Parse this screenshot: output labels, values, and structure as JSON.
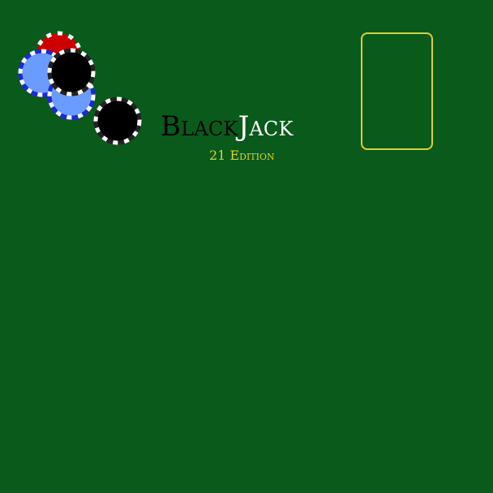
{
  "game": {
    "title_part1": "Black",
    "title_part2": "Jack",
    "subtitle": "21 Edition"
  },
  "colors": {
    "felt": "#095a1b",
    "accent": "#e2cf2a",
    "chip_red": "#cc0000",
    "chip_blue": "#6a9cff",
    "chip_blue_edge": "#1a2bd6",
    "chip_black": "#000000",
    "chip_notch": "#ffffff"
  },
  "chips": [
    {
      "color": "red"
    },
    {
      "color": "blue"
    },
    {
      "color": "blue"
    },
    {
      "color": "black"
    },
    {
      "color": "black"
    }
  ]
}
